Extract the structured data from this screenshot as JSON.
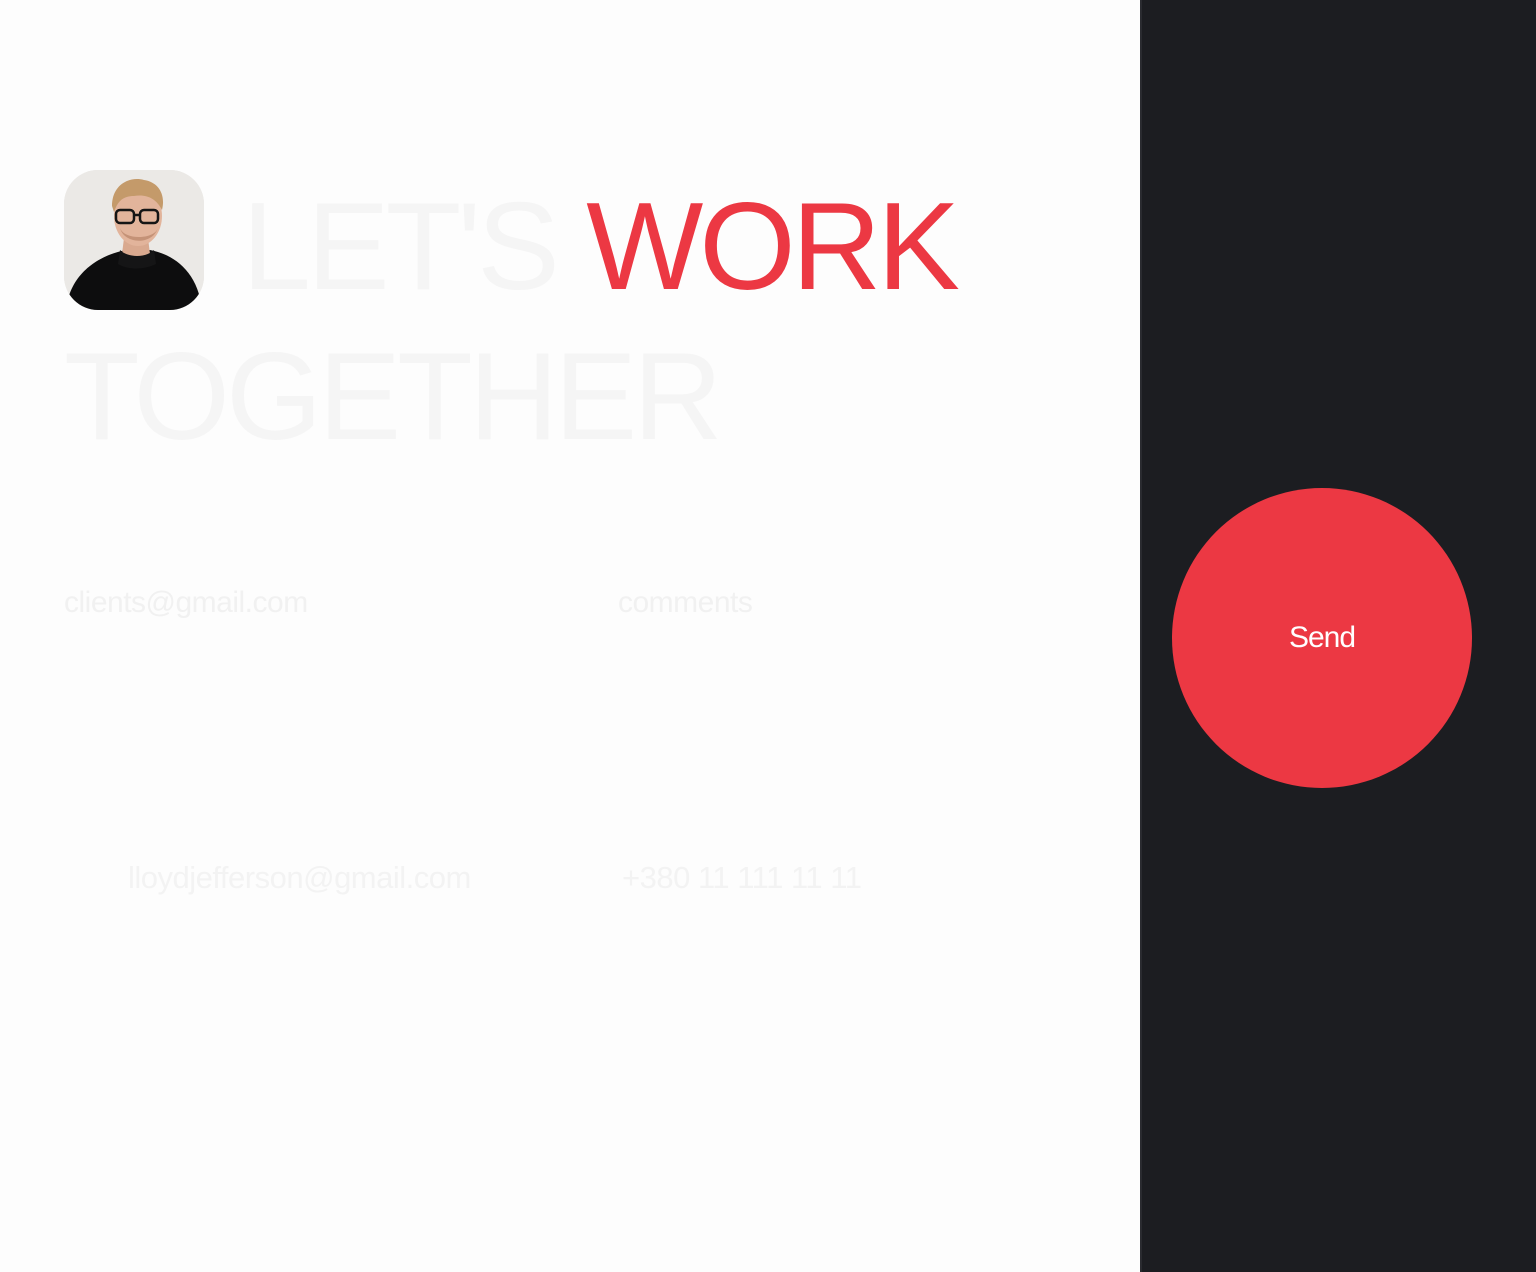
{
  "headline": {
    "line1_part1": "LET'S",
    "line1_accent": "WORK",
    "line2": "TOGETHER"
  },
  "form": {
    "email_placeholder": "clients@gmail.com",
    "comments_placeholder": "comments",
    "send_label": "Send"
  },
  "contact": {
    "email": "lloydjefferson@gmail.com",
    "phone": "+380 11 111 11 11"
  },
  "colors": {
    "accent": "#ec3843",
    "dark_panel": "#1c1d21",
    "background": "#fdfdfd"
  },
  "avatar": {
    "icon": "profile-photo"
  }
}
